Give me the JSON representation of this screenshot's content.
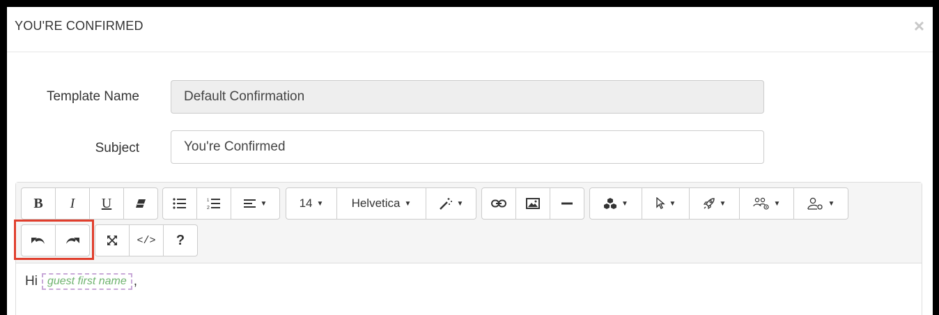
{
  "modal": {
    "title": "YOU'RE CONFIRMED",
    "close_symbol": "×"
  },
  "form": {
    "template_name_label": "Template Name",
    "template_name_value": "Default Confirmation",
    "subject_label": "Subject",
    "subject_value": "You're Confirmed"
  },
  "toolbar": {
    "bold": "B",
    "italic": "I",
    "underline": "U",
    "font_size": "14",
    "font_family": "Helvetica",
    "help": "?",
    "code_view": "</>"
  },
  "editor": {
    "greeting": "Hi",
    "placeholder_chip": "guest first name",
    "trailing": ","
  },
  "colors": {
    "highlight": "#e03e2d",
    "chip_border": "#c8a8d8",
    "chip_text": "#6fb36f"
  }
}
